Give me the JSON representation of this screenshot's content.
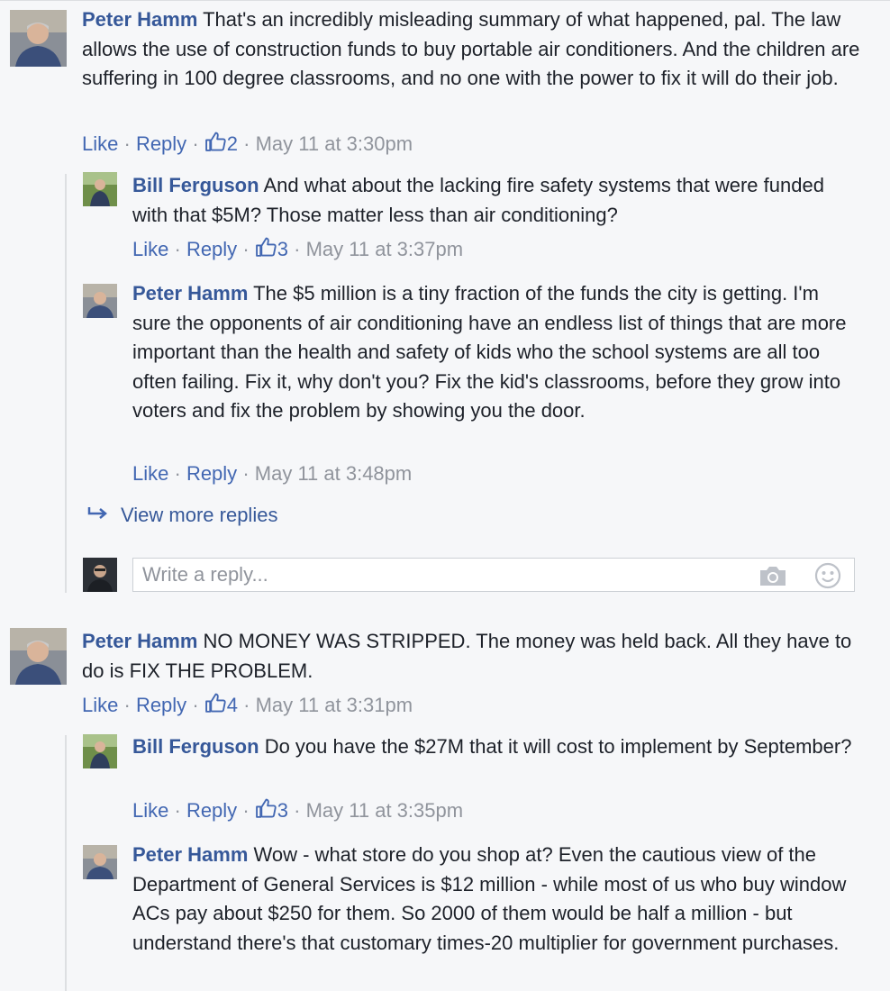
{
  "actions": {
    "like": "Like",
    "reply": "Reply",
    "sep": "·"
  },
  "icons": {
    "like_count": "thumbs-up-icon",
    "view_more": "reply-arrow-icon",
    "camera": "camera-icon",
    "emoji": "smiley-icon"
  },
  "colors": {
    "author": "#365899",
    "link": "#4267b2",
    "meta": "#90949c",
    "background": "#f6f7f9"
  },
  "comments": [
    {
      "author": "Peter Hamm",
      "text": "That's an incredibly misleading summary of what happened, pal. The law allows the use of construction funds to buy portable air conditioners. And the children are suffering in 100 degree classrooms, and no one with the power to fix it will do their job.",
      "likes": "2",
      "time": "May 11 at 3:30pm",
      "replies": [
        {
          "author": "Bill Ferguson",
          "text": "And what about the lacking fire safety systems that were funded with that $5M? Those matter less than air conditioning?",
          "likes": "3",
          "time": "May 11 at 3:37pm"
        },
        {
          "author": "Peter Hamm",
          "text": "The $5 million is a tiny fraction of the funds the city is getting. I'm sure the opponents of air conditioning have an endless list of things that are more important than the health and safety of kids who the school systems are all too often failing. Fix it, why don't you? Fix the kid's classrooms, before they grow into voters and fix the problem by showing you the door.",
          "likes": "",
          "time": "May 11 at 3:48pm"
        }
      ],
      "view_more": "View more replies",
      "reply_placeholder": "Write a reply..."
    },
    {
      "author": "Peter Hamm",
      "text": "NO MONEY WAS STRIPPED. The money was held back. All they have to do is FIX THE PROBLEM.",
      "likes": "4",
      "time": "May 11 at 3:31pm",
      "replies": [
        {
          "author": "Bill Ferguson",
          "text": "Do you have the $27M that it will cost to implement by September?",
          "likes": "3",
          "time": "May 11 at 3:35pm"
        },
        {
          "author": "Peter Hamm",
          "text": "Wow - what store do you shop at? Even the cautious view of the Department of General Services is $12 million - while most of us who buy window ACs pay about $250 for them. So 2000 of them would be half a million - but understand there's that customary times-20 multiplier for government purchases.",
          "likes": "",
          "time": ""
        }
      ]
    }
  ]
}
